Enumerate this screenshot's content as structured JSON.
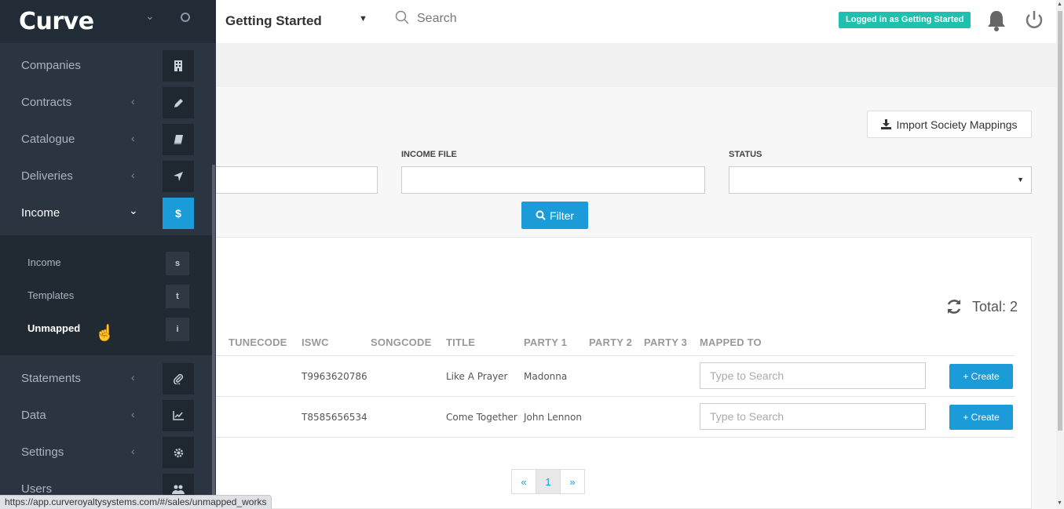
{
  "app": {
    "logo": "Curve"
  },
  "sidebar": {
    "items": [
      {
        "label": "Companies",
        "icon": "building-icon"
      },
      {
        "label": "Contracts",
        "icon": "pencil-icon"
      },
      {
        "label": "Catalogue",
        "icon": "book-icon"
      },
      {
        "label": "Deliveries",
        "icon": "send-icon"
      },
      {
        "label": "Income",
        "icon": "dollar-icon",
        "glyph": "$"
      },
      {
        "label": "Statements",
        "icon": "paperclip-icon"
      },
      {
        "label": "Data",
        "icon": "chart-line-icon"
      },
      {
        "label": "Settings",
        "icon": "gear-icon"
      },
      {
        "label": "Users",
        "icon": "users-icon"
      }
    ],
    "submenu": [
      {
        "label": "Income",
        "glyph": "s"
      },
      {
        "label": "Templates",
        "glyph": "t"
      },
      {
        "label": "Unmapped",
        "glyph": "i"
      }
    ]
  },
  "topbar": {
    "workspace": "Getting Started",
    "search_placeholder": "Search",
    "logged_in": "Logged in as Getting Started"
  },
  "toolbar": {
    "import_label": "Import Society Mappings"
  },
  "filters": {
    "income_file_label": "INCOME FILE",
    "status_label": "STATUS",
    "filter_label": "Filter"
  },
  "table": {
    "total": "Total: 2",
    "columns": [
      "TUNECODE",
      "ISWC",
      "SONGCODE",
      "TITLE",
      "PARTY 1",
      "PARTY 2",
      "PARTY 3",
      "MAPPED TO"
    ],
    "rows": [
      {
        "iswc": "T9963620786",
        "title": "Like A Prayer",
        "party1": "Madonna"
      },
      {
        "iswc": "T8585656534",
        "title": "Come Together",
        "party1": "John Lennon"
      }
    ],
    "mapped_placeholder": "Type to Search",
    "create_label": "+ Create"
  },
  "pagination": {
    "prev": "«",
    "page": "1",
    "next": "»"
  },
  "status_url": "https://app.curveroyaltysystems.com/#/sales/unmapped_works",
  "colors": {
    "accent": "#1b9bd7",
    "badge": "#1ec1ad",
    "sidebar": "#2a3541"
  }
}
